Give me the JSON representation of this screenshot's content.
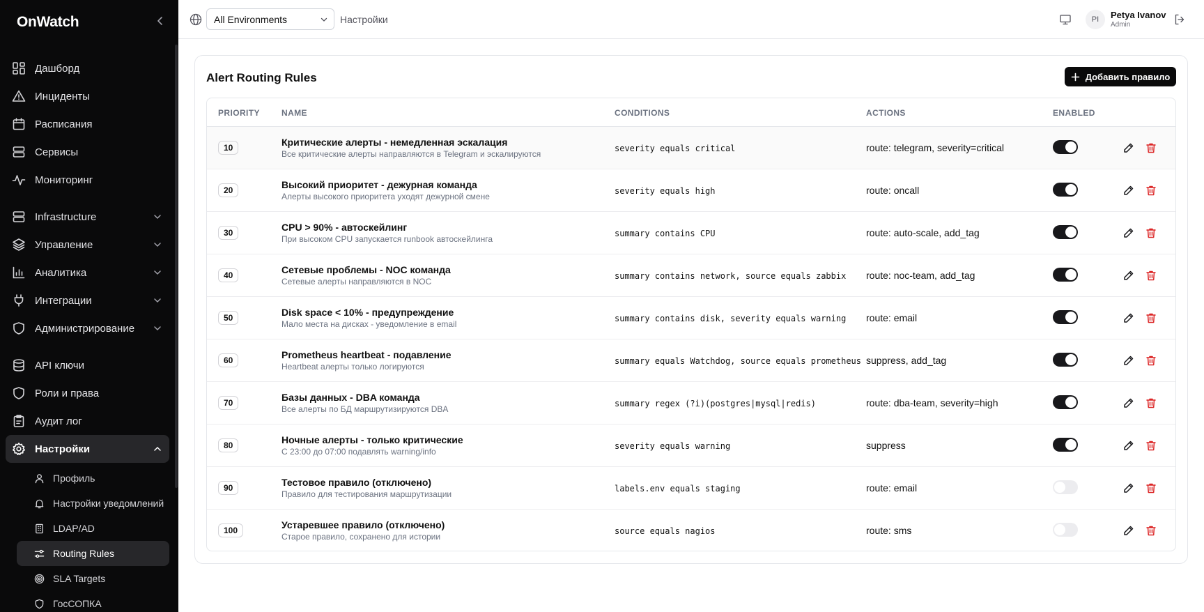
{
  "app": {
    "brand": "OnWatch"
  },
  "sidebar": {
    "items": [
      {
        "label": "Дашборд",
        "icon": "dashboard-icon"
      },
      {
        "label": "Инциденты",
        "icon": "alert-triangle-icon"
      },
      {
        "label": "Расписания",
        "icon": "calendar-icon"
      },
      {
        "label": "Сервисы",
        "icon": "server-icon"
      },
      {
        "label": "Мониторинг",
        "icon": "activity-icon"
      }
    ],
    "groups": [
      {
        "label": "Infrastructure",
        "icon": "server-icon"
      },
      {
        "label": "Управление",
        "icon": "layers-icon"
      },
      {
        "label": "Аналитика",
        "icon": "bar-chart-icon"
      },
      {
        "label": "Интеграции",
        "icon": "plug-icon"
      },
      {
        "label": "Администрирование",
        "icon": "shield-icon"
      }
    ],
    "items2": [
      {
        "label": "API ключи",
        "icon": "database-icon"
      },
      {
        "label": "Роли и права",
        "icon": "shield-icon"
      },
      {
        "label": "Аудит лог",
        "icon": "clipboard-icon"
      }
    ],
    "settings": {
      "label": "Настройки",
      "icon": "gear-icon"
    },
    "subitems": [
      {
        "label": "Профиль",
        "icon": "user-icon"
      },
      {
        "label": "Настройки уведомлений",
        "icon": "bell-icon"
      },
      {
        "label": "LDAP/AD",
        "icon": "building-icon"
      },
      {
        "label": "Routing Rules",
        "icon": "sliders-icon"
      },
      {
        "label": "SLA Targets",
        "icon": "target-icon"
      },
      {
        "label": "ГосСОПКА",
        "icon": "shield-icon"
      }
    ]
  },
  "topbar": {
    "environment": "All Environments",
    "breadcrumb": "Настройки",
    "user": {
      "initials": "PI",
      "name": "Petya Ivanov",
      "role": "Admin"
    }
  },
  "card": {
    "title": "Alert Routing Rules",
    "add_label": "Добавить правило",
    "columns": {
      "priority": "PRIORITY",
      "name": "NAME",
      "conditions": "CONDITIONS",
      "actions": "ACTIONS",
      "enabled": "ENABLED"
    }
  },
  "rules": [
    {
      "priority": "10",
      "name": "Критические алерты - немедленная эскалация",
      "desc": "Все критические алерты направляются в Telegram и эскалируются",
      "conditions": "severity equals critical",
      "actions": "route: telegram, severity=critical",
      "enabled": true
    },
    {
      "priority": "20",
      "name": "Высокий приоритет - дежурная команда",
      "desc": "Алерты высокого приоритета уходят дежурной смене",
      "conditions": "severity equals high",
      "actions": "route: oncall",
      "enabled": true
    },
    {
      "priority": "30",
      "name": "CPU > 90% - автоскейлинг",
      "desc": "При высоком CPU запускается runbook автоскейлинга",
      "conditions": "summary contains CPU",
      "actions": "route: auto-scale, add_tag",
      "enabled": true
    },
    {
      "priority": "40",
      "name": "Сетевые проблемы - NOC команда",
      "desc": "Сетевые алерты направляются в NOC",
      "conditions": "summary contains network, source equals zabbix",
      "actions": "route: noc-team, add_tag",
      "enabled": true
    },
    {
      "priority": "50",
      "name": "Disk space < 10% - предупреждение",
      "desc": "Мало места на дисках - уведомление в email",
      "conditions": "summary contains disk, severity equals warning",
      "actions": "route: email",
      "enabled": true
    },
    {
      "priority": "60",
      "name": "Prometheus heartbeat - подавление",
      "desc": "Heartbeat алерты только логируются",
      "conditions": "summary equals Watchdog, source equals prometheus",
      "actions": "suppress, add_tag",
      "enabled": true
    },
    {
      "priority": "70",
      "name": "Базы данных - DBA команда",
      "desc": "Все алерты по БД маршрутизируются DBA",
      "conditions": "summary regex (?i)(postgres|mysql|redis)",
      "actions": "route: dba-team, severity=high",
      "enabled": true
    },
    {
      "priority": "80",
      "name": "Ночные алерты - только критические",
      "desc": "С 23:00 до 07:00 подавлять warning/info",
      "conditions": "severity equals warning",
      "actions": "suppress",
      "enabled": true
    },
    {
      "priority": "90",
      "name": "Тестовое правило (отключено)",
      "desc": "Правило для тестирования маршрутизации",
      "conditions": "labels.env equals staging",
      "actions": "route: email",
      "enabled": false
    },
    {
      "priority": "100",
      "name": "Устаревшее правило (отключено)",
      "desc": "Старое правило, сохранено для истории",
      "conditions": "source equals nagios",
      "actions": "route: sms",
      "enabled": false
    }
  ],
  "colors": {
    "sidebar_bg": "#0a0a0b",
    "accent": "#0a0a0b",
    "danger": "#dc2626",
    "toggle_on": "#18181b",
    "toggle_off": "#ececef"
  }
}
